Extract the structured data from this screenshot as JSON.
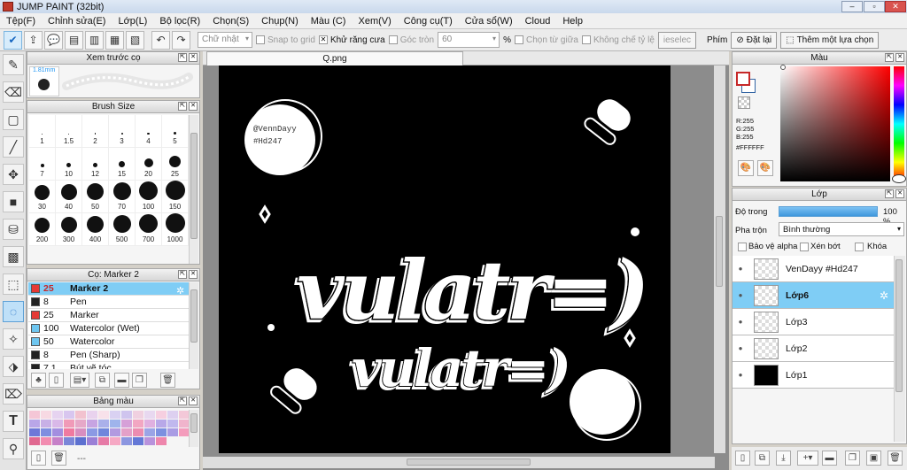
{
  "app": {
    "title": "JUMP PAINT (32bit)"
  },
  "menu": [
    "Tệp(F)",
    "Chỉnh sửa(E)",
    "Lớp(L)",
    "Bộ lọc(R)",
    "Chọn(S)",
    "Chụp(N)",
    "Màu (C)",
    "Xem(V)",
    "Công cụ(T)",
    "Cửa sổ(W)",
    "Cloud",
    "Help"
  ],
  "toolbar": {
    "shape_select": "Chữ nhật",
    "snap_label": "Snap to grid",
    "antialias_label": "Khử răng cưa",
    "round_corner_label": "Góc tròn",
    "round_value": "60",
    "percent": "%",
    "select_center_label": "Chọn từ giữa",
    "no_ratio_label": "Không chế tỷ lệ",
    "ieselec_label": "ieselec",
    "phim_label": "Phím",
    "reset_label": "Đặt lại",
    "add_selection_label": "Thêm một lựa chọn"
  },
  "preview_panel": {
    "title": "Xem trước cọ",
    "size": "1.81mm"
  },
  "brushsize_panel": {
    "title": "Brush Size",
    "sizes": [
      "1",
      "1.5",
      "2",
      "3",
      "4",
      "5",
      "7",
      "10",
      "12",
      "15",
      "20",
      "25",
      "30",
      "40",
      "50",
      "70",
      "100",
      "150",
      "200",
      "300",
      "400",
      "500",
      "700",
      "1000"
    ]
  },
  "brush_panel": {
    "title": "Cọ: Marker 2",
    "items": [
      {
        "size": "25",
        "name": "Marker 2",
        "color": "#e53935"
      },
      {
        "size": "8",
        "name": "Pen",
        "color": "#222222"
      },
      {
        "size": "25",
        "name": "Marker",
        "color": "#e53935"
      },
      {
        "size": "100",
        "name": "Watercolor (Wet)",
        "color": "#6ec6f0"
      },
      {
        "size": "50",
        "name": "Watercolor",
        "color": "#6ec6f0"
      },
      {
        "size": "8",
        "name": "Pen (Sharp)",
        "color": "#222222"
      },
      {
        "size": "7.1",
        "name": "Bút vẽ tóc",
        "color": "#222222"
      }
    ]
  },
  "palette_panel": {
    "title": "Bảng màu",
    "footer_text": "---",
    "colors": [
      "#f4c6d6",
      "#f7d9e3",
      "#e6d3f0",
      "#d8c6ef",
      "#f2c2cf",
      "#e9d2ee",
      "#f8e1ea",
      "#d9d1f2",
      "#cfc4ee",
      "#f0d0e0",
      "#e8d8f0",
      "#f6cfe0",
      "#ddd0f0",
      "#f3c8d8",
      "#b9a6e8",
      "#c8b0e6",
      "#d9b8e8",
      "#f09ab8",
      "#e6a8c8",
      "#c7a4e2",
      "#aab0ea",
      "#9fb4ec",
      "#d6a0d8",
      "#f2a6c2",
      "#e0b0e0",
      "#b8a8e8",
      "#c0b8ee",
      "#f0b4cc",
      "#6d78d8",
      "#7f8ee0",
      "#a38ee0",
      "#f07aa0",
      "#d88ec0",
      "#8b9ae4",
      "#6f86dc",
      "#b29ae0",
      "#e4a0c8",
      "#ec8cb0",
      "#9aa4e6",
      "#7c90e0",
      "#a99ce4",
      "#f49cbc",
      "#e06890",
      "#f28cb0",
      "#c680c8",
      "#7a86d8",
      "#5c70d0",
      "#9a7fd6",
      "#e67aa6",
      "#f6a8c4",
      "#8c96e0",
      "#6478d6",
      "#b892dc",
      "#ee86ac"
    ]
  },
  "canvas": {
    "tab_name": "Q.png",
    "watermark_handle": "@VennDayy",
    "watermark_tag": "#Hd247",
    "big_text": "vulatr=)",
    "small_text": "vulatr=)"
  },
  "color_panel": {
    "title": "Màu",
    "r": "R:255",
    "g": "G:255",
    "b": "B:255",
    "hex": "#FFFFFF"
  },
  "layer_panel": {
    "title": "Lớp",
    "opacity_label": "Độ trong",
    "opacity_value": "100 %",
    "blend_label": "Pha trộn",
    "blend_value": "Bình thường",
    "protect_alpha": "Bảo vệ alpha",
    "clip": "Xén bớt",
    "lock": "Khóa",
    "layers": [
      {
        "name": "VenDayy #Hd247",
        "type": "transparent"
      },
      {
        "name": "Lớp6",
        "type": "transparent"
      },
      {
        "name": "Lớp3",
        "type": "transparent"
      },
      {
        "name": "Lớp2",
        "type": "transparent"
      },
      {
        "name": "Lớp1",
        "type": "black"
      }
    ]
  }
}
